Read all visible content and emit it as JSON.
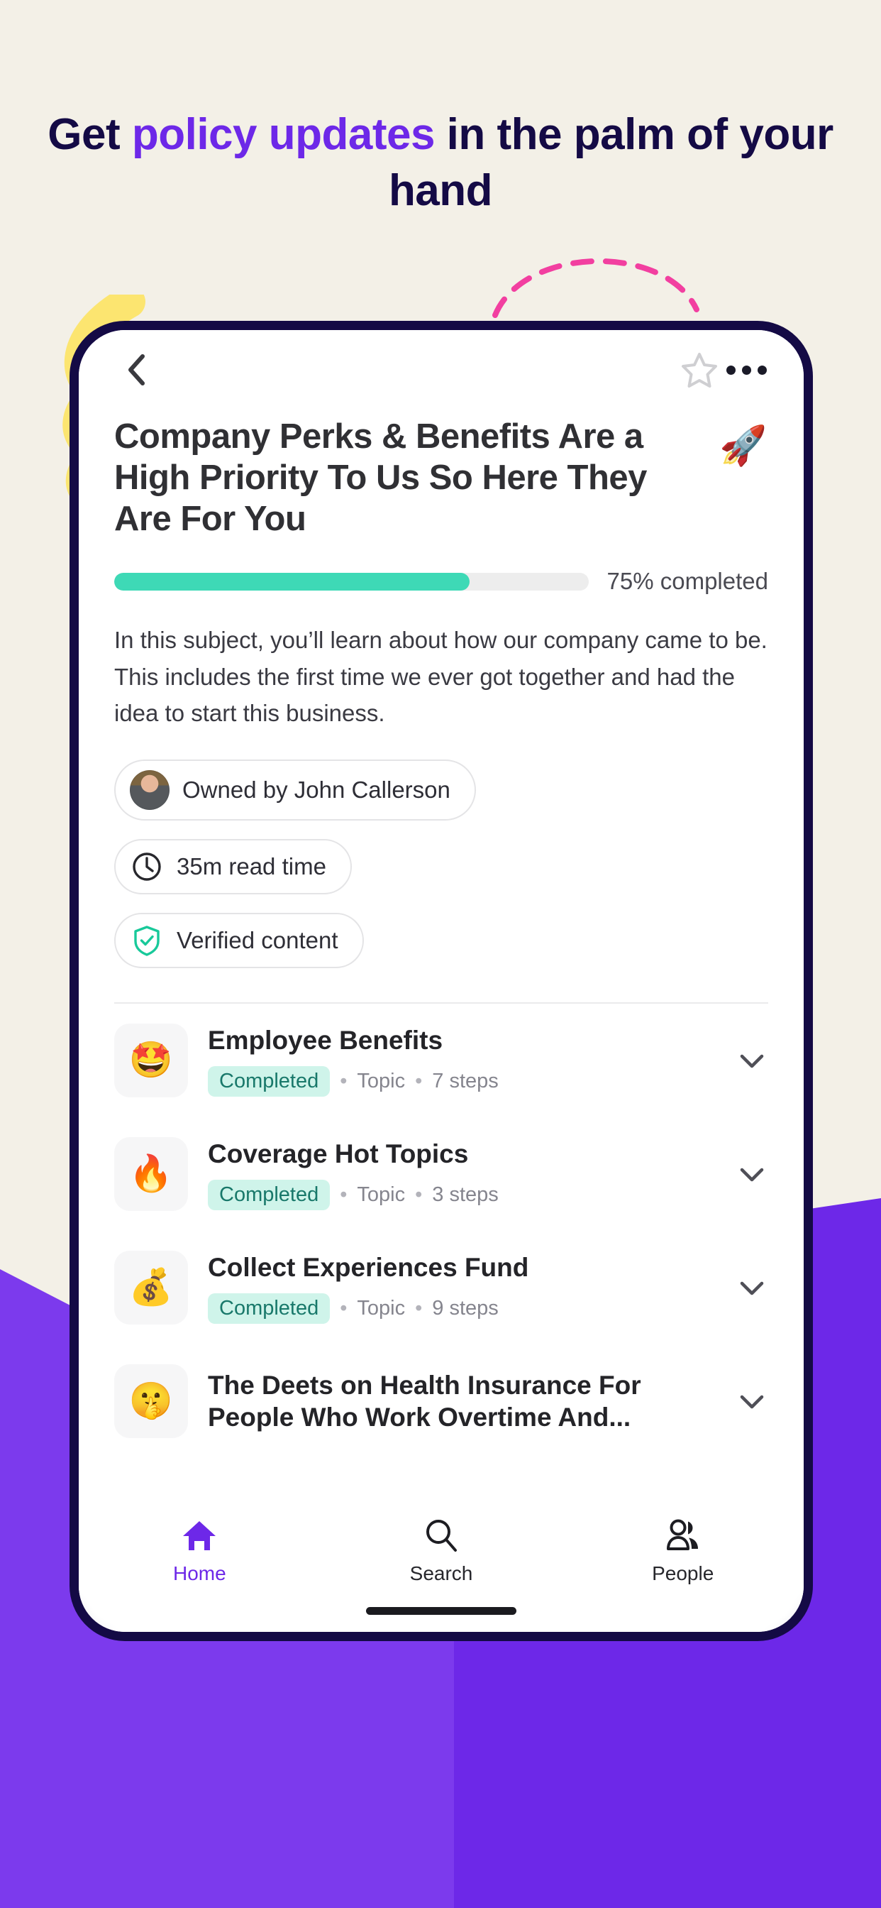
{
  "hero": {
    "headline_pre": "Get ",
    "headline_accent": "policy updates",
    "headline_post": " in the palm of your hand",
    "accent_color": "#6D28E8",
    "text_color": "#140A45",
    "background_color": "#F3F0E7"
  },
  "appbar": {
    "back_icon": "chevron-left-icon",
    "star_icon": "star-outline-icon",
    "overflow_icon": "more-horizontal-icon"
  },
  "subject": {
    "title": "Company Perks & Benefits Are a High Priority To Us So Here They Are For You",
    "emoji": "🚀",
    "progress_percent": 75,
    "progress_label": "75% completed",
    "progress_color": "#3ED9B6",
    "description": "In this subject, you’ll learn about how our company came to be. This includes the first time we ever got together and had the idea to start this business.",
    "chips": [
      {
        "id": "owner",
        "icon": "avatar",
        "label": "Owned by John Callerson"
      },
      {
        "id": "read-time",
        "icon": "clock-icon",
        "label": "35m read time"
      },
      {
        "id": "verified",
        "icon": "shield-check-icon",
        "label": "Verified content"
      }
    ]
  },
  "topics": [
    {
      "emoji": "🤩",
      "title": "Employee Benefits",
      "status": "Completed",
      "type": "Topic",
      "steps": "7 steps",
      "separator": "•"
    },
    {
      "emoji": "🔥",
      "title": "Coverage Hot Topics",
      "status": "Completed",
      "type": "Topic",
      "steps": "3 steps",
      "separator": "•"
    },
    {
      "emoji": "💰",
      "title": "Collect Experiences Fund",
      "status": "Completed",
      "type": "Topic",
      "steps": "9 steps",
      "separator": "•"
    },
    {
      "emoji": "🤫",
      "title": "The Deets on Health Insurance For People Who Work Overtime And...",
      "status": "",
      "type": "",
      "steps": "",
      "separator": ""
    }
  ],
  "bottom_nav": {
    "items": [
      {
        "id": "home",
        "label": "Home",
        "icon": "home-icon",
        "active": true
      },
      {
        "id": "search",
        "label": "Search",
        "icon": "search-icon",
        "active": false
      },
      {
        "id": "people",
        "label": "People",
        "icon": "people-icon",
        "active": false
      }
    ],
    "active_color": "#6D28E8"
  }
}
